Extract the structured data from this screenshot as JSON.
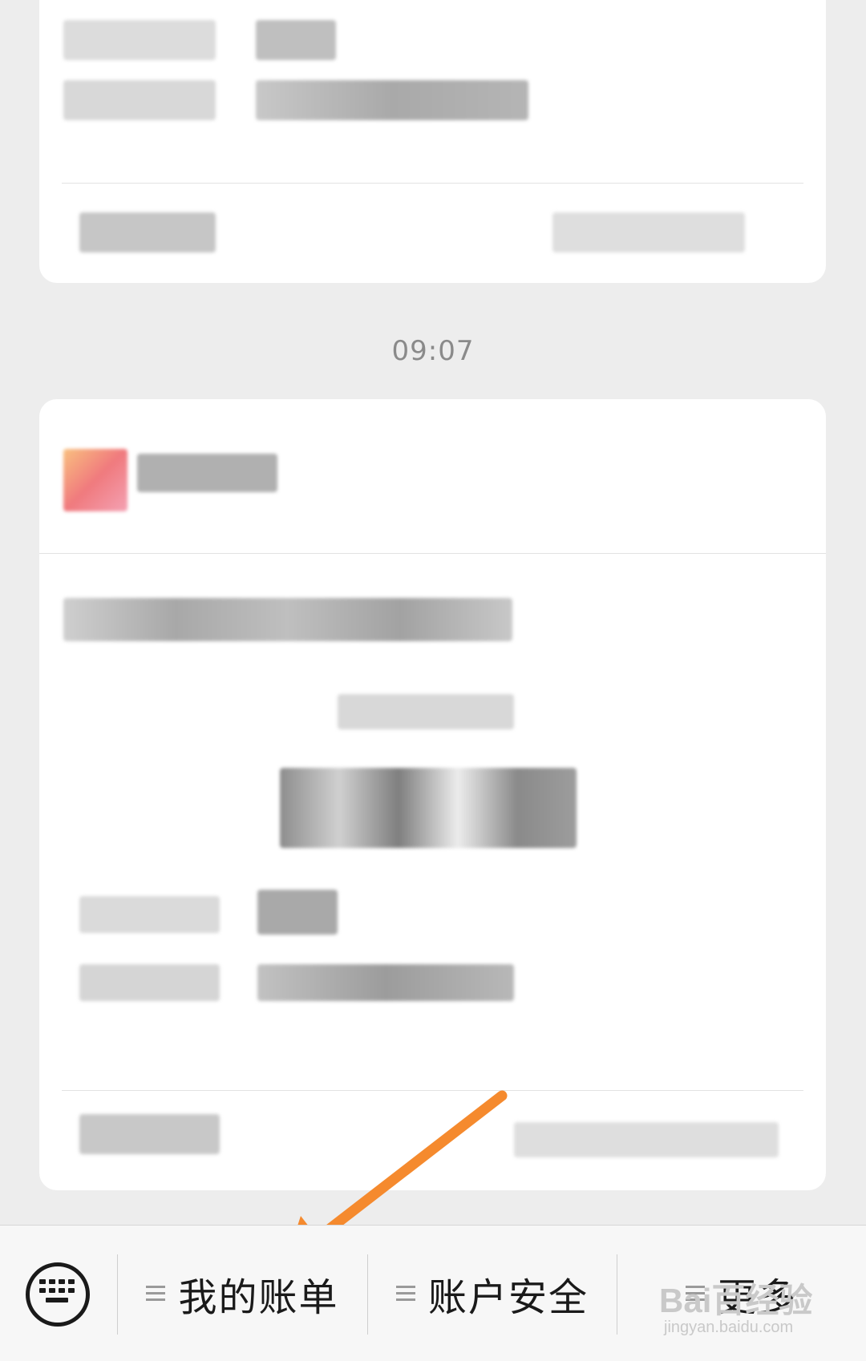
{
  "conversation": {
    "timestamp": "09:07"
  },
  "menu": {
    "items": [
      {
        "label": "我的账单"
      },
      {
        "label": "账户安全"
      },
      {
        "label": "更多"
      }
    ]
  },
  "watermark": {
    "main": "Bai百经验",
    "sub": "jingyan.baidu.com"
  },
  "icons": {
    "keyboard": "keyboard-icon",
    "menu": "list-menu-icon"
  },
  "colors": {
    "background": "#ededed",
    "card": "#ffffff",
    "annotation_arrow": "#f58a2e"
  }
}
